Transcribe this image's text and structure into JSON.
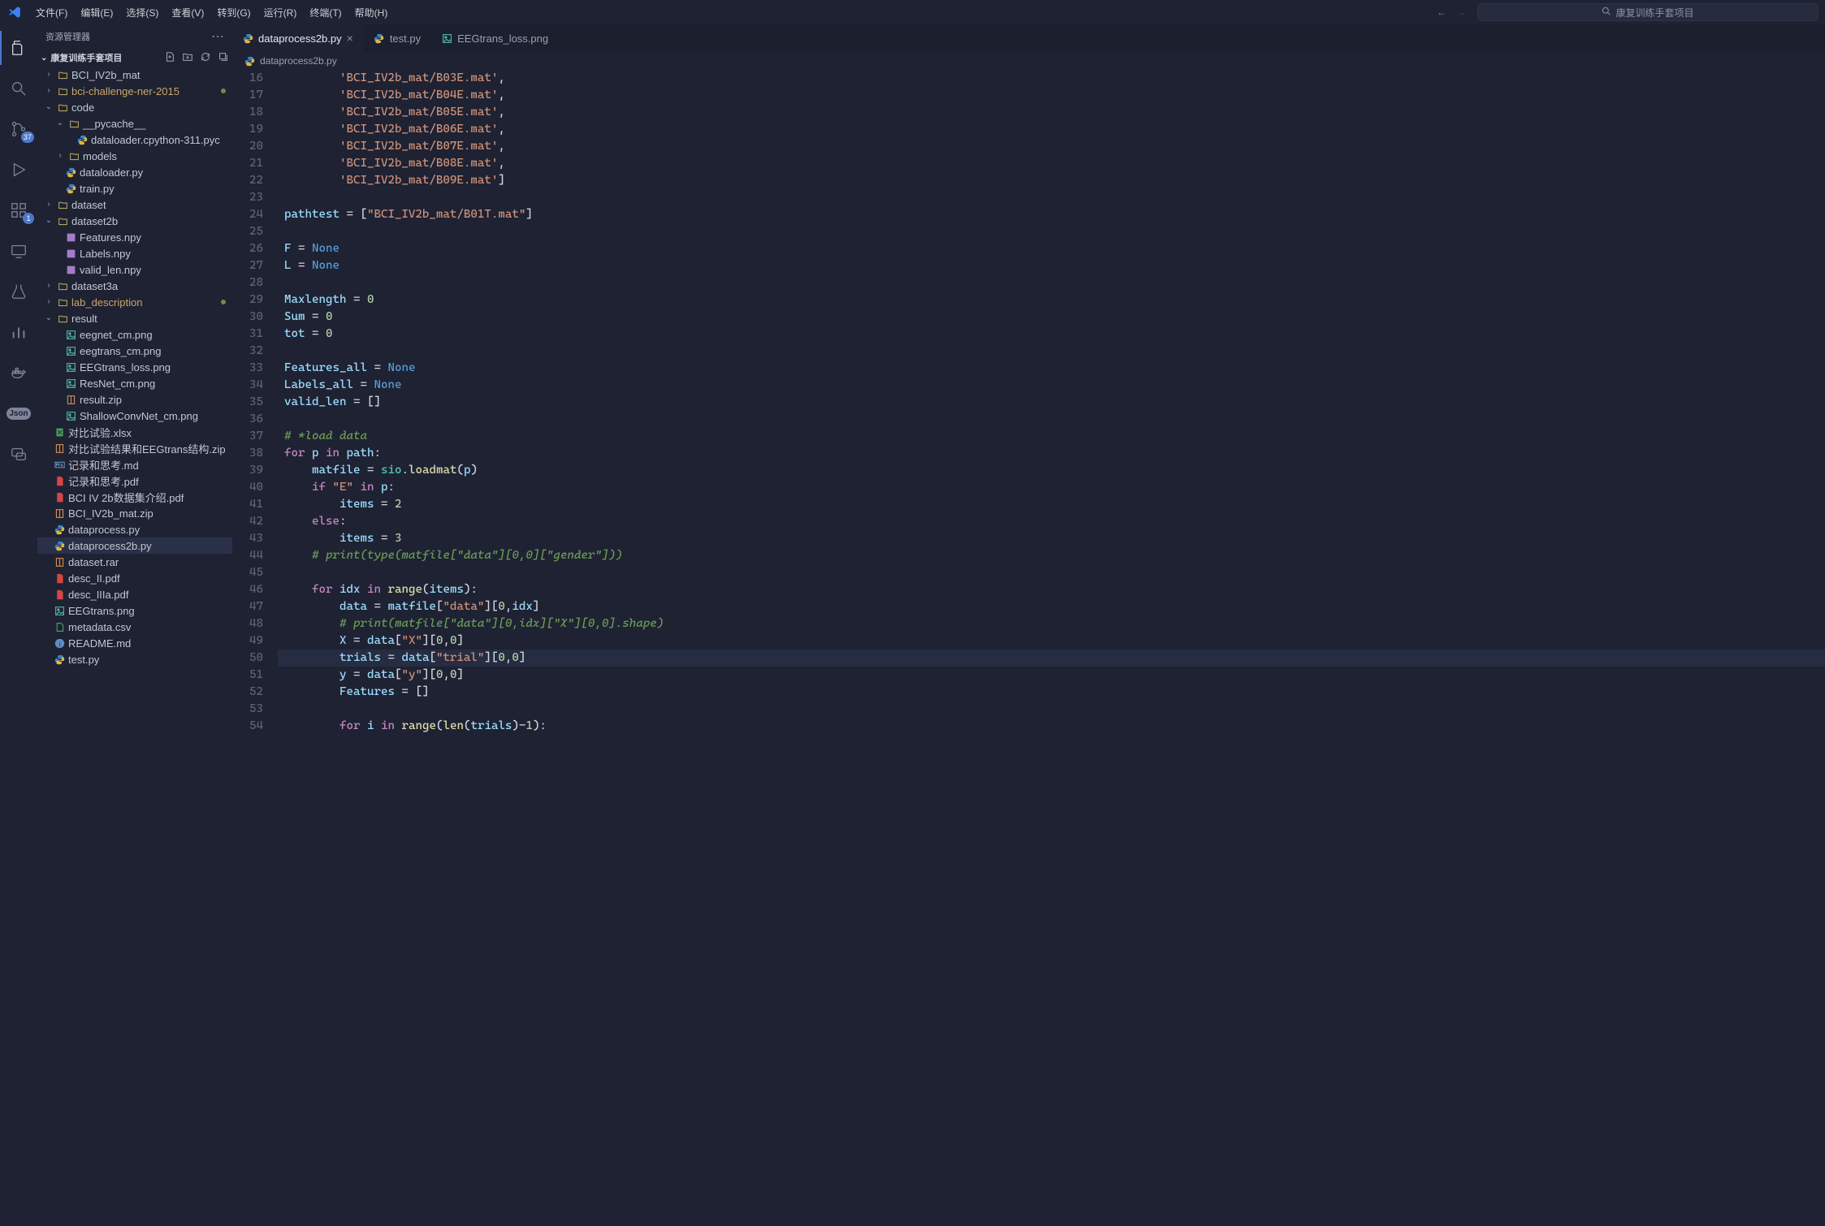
{
  "menu": {
    "items": [
      "文件(F)",
      "编辑(E)",
      "选择(S)",
      "查看(V)",
      "转到(G)",
      "运行(R)",
      "终端(T)",
      "帮助(H)"
    ]
  },
  "search": {
    "placeholder": "康复训练手套项目"
  },
  "activity": {
    "source_badge": "37",
    "ext_badge": "1"
  },
  "sidebar": {
    "title": "资源管理器",
    "project": "康复训练手套项目"
  },
  "tree": [
    {
      "d": 0,
      "t": "folder",
      "c": "›",
      "name": "BCI_IV2b_mat"
    },
    {
      "d": 0,
      "t": "folder",
      "c": "›",
      "name": "bci-challenge-ner-2015",
      "hl": true,
      "dot": true
    },
    {
      "d": 0,
      "t": "folder",
      "c": "⌄",
      "name": "code"
    },
    {
      "d": 1,
      "t": "folder",
      "c": "⌄",
      "name": "__pycache__"
    },
    {
      "d": 2,
      "t": "file",
      "i": "py",
      "name": "dataloader.cpython-311.pyc"
    },
    {
      "d": 1,
      "t": "folder",
      "c": "›",
      "name": "models"
    },
    {
      "d": 1,
      "t": "file",
      "i": "py",
      "name": "dataloader.py"
    },
    {
      "d": 1,
      "t": "file",
      "i": "py",
      "name": "train.py"
    },
    {
      "d": 0,
      "t": "folder",
      "c": "›",
      "name": "dataset"
    },
    {
      "d": 0,
      "t": "folder",
      "c": "⌄",
      "name": "dataset2b"
    },
    {
      "d": 1,
      "t": "file",
      "i": "npy",
      "name": "Features.npy"
    },
    {
      "d": 1,
      "t": "file",
      "i": "npy",
      "name": "Labels.npy"
    },
    {
      "d": 1,
      "t": "file",
      "i": "npy",
      "name": "valid_len.npy"
    },
    {
      "d": 0,
      "t": "folder",
      "c": "›",
      "name": "dataset3a"
    },
    {
      "d": 0,
      "t": "folder",
      "c": "›",
      "name": "lab_description",
      "hl": true,
      "dot": true
    },
    {
      "d": 0,
      "t": "folder",
      "c": "⌄",
      "name": "result"
    },
    {
      "d": 1,
      "t": "file",
      "i": "png",
      "name": "eegnet_cm.png"
    },
    {
      "d": 1,
      "t": "file",
      "i": "png",
      "name": "eegtrans_cm.png"
    },
    {
      "d": 1,
      "t": "file",
      "i": "png",
      "name": "EEGtrans_loss.png"
    },
    {
      "d": 1,
      "t": "file",
      "i": "png",
      "name": "ResNet_cm.png"
    },
    {
      "d": 1,
      "t": "file",
      "i": "zip",
      "name": "result.zip"
    },
    {
      "d": 1,
      "t": "file",
      "i": "png",
      "name": "ShallowConvNet_cm.png"
    },
    {
      "d": 0,
      "t": "file",
      "i": "xlsx",
      "name": "对比试验.xlsx"
    },
    {
      "d": 0,
      "t": "file",
      "i": "zip",
      "name": "对比试验结果和EEGtrans结构.zip"
    },
    {
      "d": 0,
      "t": "file",
      "i": "md",
      "name": "记录和思考.md"
    },
    {
      "d": 0,
      "t": "file",
      "i": "pdf",
      "name": "记录和思考.pdf"
    },
    {
      "d": 0,
      "t": "file",
      "i": "pdf",
      "name": "BCI IV 2b数据集介绍.pdf"
    },
    {
      "d": 0,
      "t": "file",
      "i": "zip",
      "name": "BCI_IV2b_mat.zip"
    },
    {
      "d": 0,
      "t": "file",
      "i": "py",
      "name": "dataprocess.py"
    },
    {
      "d": 0,
      "t": "file",
      "i": "py",
      "name": "dataprocess2b.py",
      "active": true
    },
    {
      "d": 0,
      "t": "file",
      "i": "rar",
      "name": "dataset.rar"
    },
    {
      "d": 0,
      "t": "file",
      "i": "pdf",
      "name": "desc_II.pdf"
    },
    {
      "d": 0,
      "t": "file",
      "i": "pdf",
      "name": "desc_IIIa.pdf"
    },
    {
      "d": 0,
      "t": "file",
      "i": "png",
      "name": "EEGtrans.png"
    },
    {
      "d": 0,
      "t": "file",
      "i": "csv",
      "name": "metadata.csv"
    },
    {
      "d": 0,
      "t": "file",
      "i": "info",
      "name": "README.md"
    },
    {
      "d": 0,
      "t": "file",
      "i": "py",
      "name": "test.py"
    }
  ],
  "tabs": [
    {
      "label": "dataprocess2b.py",
      "icon": "py",
      "active": true,
      "close": true
    },
    {
      "label": "test.py",
      "icon": "py"
    },
    {
      "label": "EEGtrans_loss.png",
      "icon": "png"
    }
  ],
  "crumb": {
    "icon": "py",
    "label": "dataprocess2b.py"
  },
  "code": {
    "start": 16,
    "highlight_rel": 34,
    "lines": [
      [
        [
          "        "
        ],
        [
          "'BCI_IV2b_mat/B03E.mat'",
          "str"
        ],
        [
          ","
        ]
      ],
      [
        [
          "        "
        ],
        [
          "'BCI_IV2b_mat/B04E.mat'",
          "str"
        ],
        [
          ","
        ]
      ],
      [
        [
          "        "
        ],
        [
          "'BCI_IV2b_mat/B05E.mat'",
          "str"
        ],
        [
          ","
        ]
      ],
      [
        [
          "        "
        ],
        [
          "'BCI_IV2b_mat/B06E.mat'",
          "str"
        ],
        [
          ","
        ]
      ],
      [
        [
          "        "
        ],
        [
          "'BCI_IV2b_mat/B07E.mat'",
          "str"
        ],
        [
          ","
        ]
      ],
      [
        [
          "        "
        ],
        [
          "'BCI_IV2b_mat/B08E.mat'",
          "str"
        ],
        [
          ","
        ]
      ],
      [
        [
          "        "
        ],
        [
          "'BCI_IV2b_mat/B09E.mat'",
          "str"
        ],
        [
          "]"
        ]
      ],
      [
        [
          ""
        ]
      ],
      [
        [
          "pathtest",
          "var"
        ],
        [
          " = ["
        ],
        [
          "\"BCI_IV2b_mat/B01T.mat\"",
          "str"
        ],
        [
          "]"
        ]
      ],
      [
        [
          ""
        ]
      ],
      [
        [
          "F",
          "var"
        ],
        [
          " = "
        ],
        [
          "None",
          "const"
        ]
      ],
      [
        [
          "L",
          "var"
        ],
        [
          " = "
        ],
        [
          "None",
          "const"
        ]
      ],
      [
        [
          ""
        ]
      ],
      [
        [
          "Maxlength",
          "var"
        ],
        [
          " = "
        ],
        [
          "0",
          "num"
        ]
      ],
      [
        [
          "Sum",
          "var"
        ],
        [
          " = "
        ],
        [
          "0",
          "num"
        ]
      ],
      [
        [
          "tot",
          "var"
        ],
        [
          " = "
        ],
        [
          "0",
          "num"
        ]
      ],
      [
        [
          ""
        ]
      ],
      [
        [
          "Features_all",
          "var"
        ],
        [
          " = "
        ],
        [
          "None",
          "const"
        ]
      ],
      [
        [
          "Labels_all",
          "var"
        ],
        [
          " = "
        ],
        [
          "None",
          "const"
        ]
      ],
      [
        [
          "valid_len",
          "var"
        ],
        [
          " = []"
        ]
      ],
      [
        [
          ""
        ]
      ],
      [
        [
          "# *load data",
          "cmt"
        ]
      ],
      [
        [
          "for",
          "kw2"
        ],
        [
          " "
        ],
        [
          "p",
          "var"
        ],
        [
          " "
        ],
        [
          "in",
          "kw2"
        ],
        [
          " "
        ],
        [
          "path",
          "var"
        ],
        [
          ":"
        ]
      ],
      [
        [
          "    "
        ],
        [
          "matfile",
          "var"
        ],
        [
          " = "
        ],
        [
          "sio",
          "mod"
        ],
        [
          "."
        ],
        [
          "loadmat",
          "call"
        ],
        [
          "("
        ],
        [
          "p",
          "var"
        ],
        [
          ")"
        ]
      ],
      [
        [
          "    "
        ],
        [
          "if",
          "kw2"
        ],
        [
          " "
        ],
        [
          "\"E\"",
          "str"
        ],
        [
          " "
        ],
        [
          "in",
          "kw2"
        ],
        [
          " "
        ],
        [
          "p",
          "var"
        ],
        [
          ":"
        ]
      ],
      [
        [
          "        "
        ],
        [
          "items",
          "var"
        ],
        [
          " = "
        ],
        [
          "2",
          "num"
        ]
      ],
      [
        [
          "    "
        ],
        [
          "else",
          "kw2"
        ],
        [
          ":"
        ]
      ],
      [
        [
          "        "
        ],
        [
          "items",
          "var"
        ],
        [
          " = "
        ],
        [
          "3",
          "num"
        ]
      ],
      [
        [
          "    "
        ],
        [
          "# print(type(matfile[\"data\"][0,0][\"gender\"]))",
          "cmt"
        ]
      ],
      [
        [
          ""
        ]
      ],
      [
        [
          "    "
        ],
        [
          "for",
          "kw2"
        ],
        [
          " "
        ],
        [
          "idx",
          "var"
        ],
        [
          " "
        ],
        [
          "in",
          "kw2"
        ],
        [
          " "
        ],
        [
          "range",
          "call"
        ],
        [
          "("
        ],
        [
          "items",
          "var"
        ],
        [
          "):"
        ]
      ],
      [
        [
          "        "
        ],
        [
          "data",
          "var"
        ],
        [
          " = "
        ],
        [
          "matfile",
          "var"
        ],
        [
          "["
        ],
        [
          "\"data\"",
          "str"
        ],
        [
          "]["
        ],
        [
          "0",
          "num"
        ],
        [
          ","
        ],
        [
          "idx",
          "var"
        ],
        [
          "]"
        ]
      ],
      [
        [
          "        "
        ],
        [
          "# print(matfile[\"data\"][0,idx][\"X\"][0,0].shape)",
          "cmt"
        ]
      ],
      [
        [
          "        "
        ],
        [
          "X",
          "var"
        ],
        [
          " = "
        ],
        [
          "data",
          "var"
        ],
        [
          "["
        ],
        [
          "\"X\"",
          "str"
        ],
        [
          "]["
        ],
        [
          "0",
          "num"
        ],
        [
          ","
        ],
        [
          "0",
          "num"
        ],
        [
          "]"
        ]
      ],
      [
        [
          "        "
        ],
        [
          "trials",
          "var"
        ],
        [
          " = "
        ],
        [
          "data",
          "var"
        ],
        [
          "["
        ],
        [
          "\"trial\"",
          "str"
        ],
        [
          "]["
        ],
        [
          "0",
          "num"
        ],
        [
          ","
        ],
        [
          "0",
          "num"
        ],
        [
          "]"
        ]
      ],
      [
        [
          "        "
        ],
        [
          "y",
          "var"
        ],
        [
          " = "
        ],
        [
          "data",
          "var"
        ],
        [
          "["
        ],
        [
          "\"y\"",
          "str"
        ],
        [
          "]["
        ],
        [
          "0",
          "num"
        ],
        [
          ","
        ],
        [
          "0",
          "num"
        ],
        [
          "]"
        ]
      ],
      [
        [
          "        "
        ],
        [
          "Features",
          "var"
        ],
        [
          " = []"
        ]
      ],
      [
        [
          ""
        ]
      ],
      [
        [
          "        "
        ],
        [
          "for",
          "kw2"
        ],
        [
          " "
        ],
        [
          "i",
          "var"
        ],
        [
          " "
        ],
        [
          "in",
          "kw2"
        ],
        [
          " "
        ],
        [
          "range",
          "call"
        ],
        [
          "("
        ],
        [
          "len",
          "call"
        ],
        [
          "("
        ],
        [
          "trials",
          "var"
        ],
        [
          ")-"
        ],
        [
          "1",
          "num"
        ],
        [
          "):"
        ]
      ]
    ]
  },
  "icons": {
    "folder": "▸",
    "folderOpen": "▾"
  }
}
